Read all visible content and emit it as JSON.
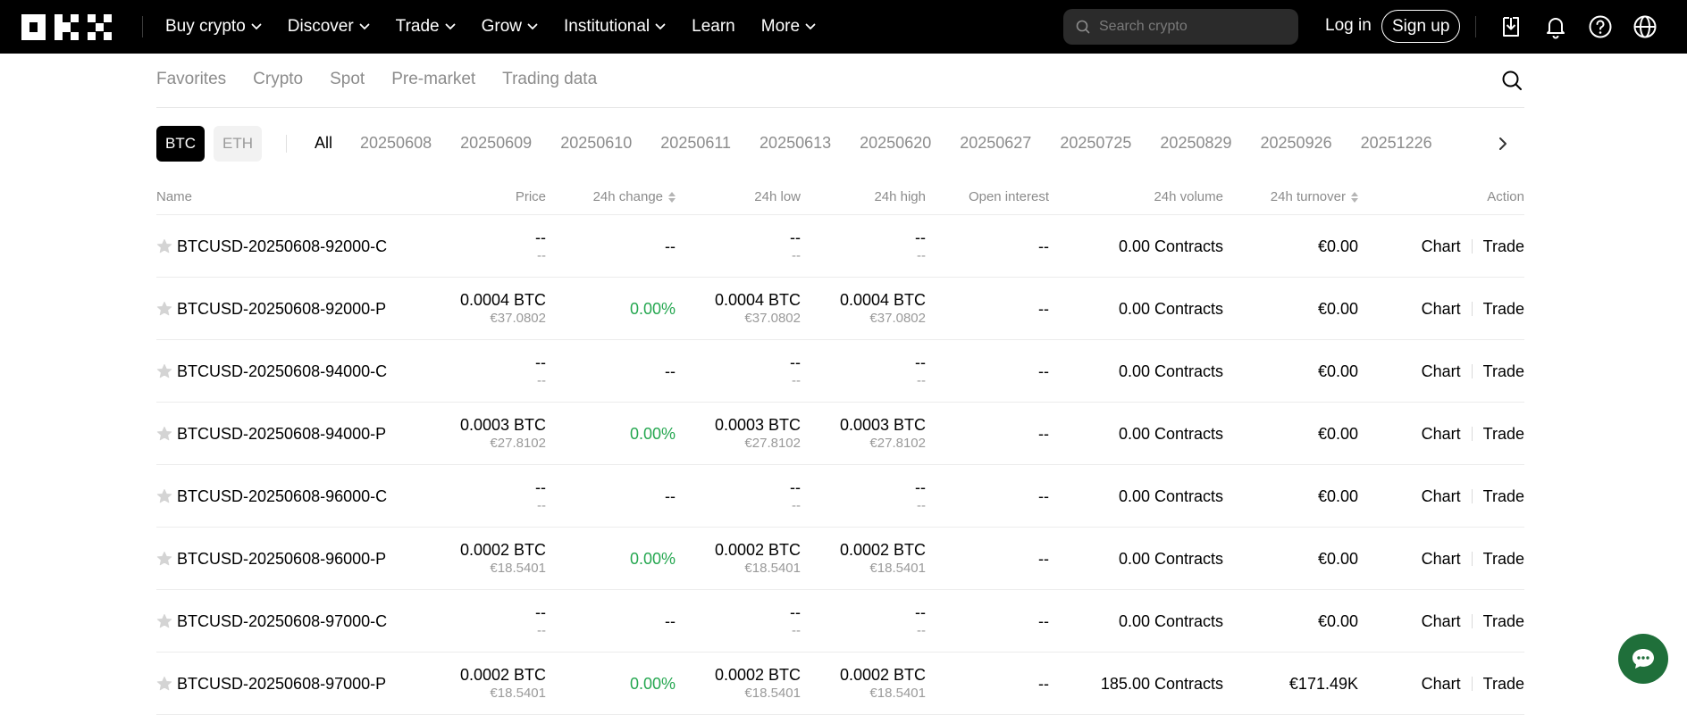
{
  "nav": {
    "items": [
      {
        "label": "Buy crypto",
        "chevron": true
      },
      {
        "label": "Discover",
        "chevron": true
      },
      {
        "label": "Trade",
        "chevron": true
      },
      {
        "label": "Grow",
        "chevron": true
      },
      {
        "label": "Institutional",
        "chevron": true
      },
      {
        "label": "Learn",
        "chevron": false
      },
      {
        "label": "More",
        "chevron": true
      }
    ],
    "search_placeholder": "Search crypto",
    "login": "Log in",
    "signup": "Sign up"
  },
  "subtabs": [
    "Favorites",
    "Crypto",
    "Spot",
    "Pre-market",
    "Trading data"
  ],
  "filters": {
    "coins": [
      "BTC",
      "ETH"
    ],
    "selected_coin": "BTC",
    "dates": [
      "All",
      "20250608",
      "20250609",
      "20250610",
      "20250611",
      "20250613",
      "20250620",
      "20250627",
      "20250725",
      "20250829",
      "20250926",
      "20251226"
    ],
    "selected_date": "All"
  },
  "table": {
    "headers": {
      "name": "Name",
      "price": "Price",
      "change": "24h change",
      "low": "24h low",
      "high": "24h high",
      "oi": "Open interest",
      "volume": "24h volume",
      "turnover": "24h turnover",
      "action": "Action"
    },
    "action_labels": {
      "chart": "Chart",
      "trade": "Trade"
    },
    "rows": [
      {
        "name": "BTCUSD-20250608-92000-C",
        "price": "--",
        "price_sub": "--",
        "change": "--",
        "change_positive": false,
        "low": "--",
        "low_sub": "--",
        "high": "--",
        "high_sub": "--",
        "oi": "--",
        "volume": "0.00 Contracts",
        "turnover": "€0.00"
      },
      {
        "name": "BTCUSD-20250608-92000-P",
        "price": "0.0004 BTC",
        "price_sub": "€37.0802",
        "change": "0.00%",
        "change_positive": true,
        "low": "0.0004 BTC",
        "low_sub": "€37.0802",
        "high": "0.0004 BTC",
        "high_sub": "€37.0802",
        "oi": "--",
        "volume": "0.00 Contracts",
        "turnover": "€0.00"
      },
      {
        "name": "BTCUSD-20250608-94000-C",
        "price": "--",
        "price_sub": "--",
        "change": "--",
        "change_positive": false,
        "low": "--",
        "low_sub": "--",
        "high": "--",
        "high_sub": "--",
        "oi": "--",
        "volume": "0.00 Contracts",
        "turnover": "€0.00"
      },
      {
        "name": "BTCUSD-20250608-94000-P",
        "price": "0.0003 BTC",
        "price_sub": "€27.8102",
        "change": "0.00%",
        "change_positive": true,
        "low": "0.0003 BTC",
        "low_sub": "€27.8102",
        "high": "0.0003 BTC",
        "high_sub": "€27.8102",
        "oi": "--",
        "volume": "0.00 Contracts",
        "turnover": "€0.00"
      },
      {
        "name": "BTCUSD-20250608-96000-C",
        "price": "--",
        "price_sub": "--",
        "change": "--",
        "change_positive": false,
        "low": "--",
        "low_sub": "--",
        "high": "--",
        "high_sub": "--",
        "oi": "--",
        "volume": "0.00 Contracts",
        "turnover": "€0.00"
      },
      {
        "name": "BTCUSD-20250608-96000-P",
        "price": "0.0002 BTC",
        "price_sub": "€18.5401",
        "change": "0.00%",
        "change_positive": true,
        "low": "0.0002 BTC",
        "low_sub": "€18.5401",
        "high": "0.0002 BTC",
        "high_sub": "€18.5401",
        "oi": "--",
        "volume": "0.00 Contracts",
        "turnover": "€0.00"
      },
      {
        "name": "BTCUSD-20250608-97000-C",
        "price": "--",
        "price_sub": "--",
        "change": "--",
        "change_positive": false,
        "low": "--",
        "low_sub": "--",
        "high": "--",
        "high_sub": "--",
        "oi": "--",
        "volume": "0.00 Contracts",
        "turnover": "€0.00"
      },
      {
        "name": "BTCUSD-20250608-97000-P",
        "price": "0.0002 BTC",
        "price_sub": "€18.5401",
        "change": "0.00%",
        "change_positive": true,
        "low": "0.0002 BTC",
        "low_sub": "€18.5401",
        "high": "0.0002 BTC",
        "high_sub": "€18.5401",
        "oi": "--",
        "volume": "185.00 Contracts",
        "turnover": "€171.49K"
      }
    ]
  },
  "colors": {
    "positive": "#25a750",
    "nav_bg": "#000000",
    "chat_bg": "#1f6f3a"
  },
  "icons": [
    "okx-logo",
    "chevron-down-icon",
    "search-icon",
    "download-icon",
    "bell-icon",
    "help-icon",
    "globe-icon",
    "star-icon",
    "sort-icon",
    "chevron-right-icon",
    "chat-icon"
  ]
}
